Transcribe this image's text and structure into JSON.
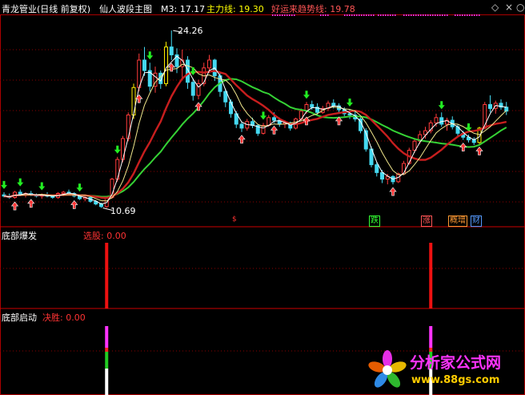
{
  "header": {
    "title": "青龙管业(日线 前复权)",
    "indicator": "仙人波段主图",
    "m3": "M3: 17.17",
    "main_line": "主力线: 19.30",
    "lucky_line": "好运来趋势线: 19.78"
  },
  "panels": {
    "p2_name": "底部爆发",
    "p2_signal": "选股: 0.00",
    "p3_name": "底部启动",
    "p3_signal": "决胜: 0.00"
  },
  "annotations": {
    "high": "24.26",
    "low": "10.69",
    "tags": [
      "跌",
      "涨",
      "概增",
      "财"
    ],
    "small_mark": "$"
  },
  "watermark": {
    "cn": "分析家公式网",
    "url": "www.88gs.com"
  },
  "colors": {
    "up": "#ff3b3b",
    "down": "#44d8f0",
    "ma_slow": "#c81e1e",
    "ma_green": "#35d235",
    "ma_white": "#ffffff",
    "ma_yellow": "#f0e68c",
    "magenta": "#ff33ff",
    "grid": "#8b0000"
  },
  "chart_data": {
    "type": "candlestick",
    "y_high": 24.26,
    "y_low": 10.69,
    "current": {
      "m3": 17.17,
      "main_line": 19.3,
      "lucky_line": 19.78
    },
    "ohlc": [
      [
        11.7,
        11.9,
        11.5,
        11.6
      ],
      [
        11.6,
        11.8,
        11.4,
        11.5
      ],
      [
        11.5,
        12.0,
        11.4,
        11.9
      ],
      [
        11.9,
        12.1,
        11.6,
        11.7
      ],
      [
        11.7,
        11.9,
        11.5,
        11.8
      ],
      [
        11.8,
        12.0,
        11.6,
        11.7
      ],
      [
        11.7,
        11.8,
        11.5,
        11.6
      ],
      [
        11.6,
        11.8,
        11.4,
        11.7
      ],
      [
        11.7,
        11.9,
        11.5,
        11.6
      ],
      [
        11.6,
        11.7,
        11.4,
        11.5
      ],
      [
        11.5,
        11.9,
        11.4,
        11.8
      ],
      [
        11.8,
        12.0,
        11.6,
        11.9
      ],
      [
        11.9,
        12.1,
        11.7,
        11.8
      ],
      [
        11.8,
        11.9,
        11.5,
        11.6
      ],
      [
        11.6,
        11.7,
        11.3,
        11.4
      ],
      [
        11.4,
        11.6,
        11.2,
        11.5
      ],
      [
        11.5,
        11.6,
        11.1,
        11.2
      ],
      [
        11.2,
        11.3,
        10.9,
        11.0
      ],
      [
        11.0,
        11.1,
        10.7,
        10.8
      ],
      [
        10.8,
        11.6,
        10.7,
        11.5
      ],
      [
        11.5,
        13.0,
        11.4,
        12.9
      ],
      [
        12.9,
        14.6,
        12.7,
        14.4
      ],
      [
        14.4,
        16.2,
        14.2,
        16.0
      ],
      [
        16.0,
        18.0,
        15.8,
        17.8
      ],
      [
        17.8,
        20.2,
        17.5,
        19.9
      ],
      [
        19.9,
        22.5,
        19.6,
        22.0
      ],
      [
        22.0,
        23.0,
        20.8,
        21.2
      ],
      [
        21.2,
        21.8,
        19.6,
        20.0
      ],
      [
        20.0,
        21.5,
        19.5,
        21.0
      ],
      [
        21.0,
        21.2,
        19.8,
        20.2
      ],
      [
        20.2,
        23.4,
        20.0,
        23.0
      ],
      [
        23.0,
        24.26,
        22.0,
        22.4
      ],
      [
        22.4,
        22.9,
        21.0,
        21.5
      ],
      [
        21.5,
        22.8,
        20.5,
        22.0
      ],
      [
        22.0,
        22.3,
        19.8,
        20.3
      ],
      [
        20.3,
        20.6,
        18.9,
        19.3
      ],
      [
        19.3,
        20.5,
        19.0,
        20.2
      ],
      [
        20.2,
        21.8,
        20.0,
        21.4
      ],
      [
        21.4,
        22.4,
        21.0,
        22.0
      ],
      [
        22.0,
        22.1,
        20.4,
        20.8
      ],
      [
        20.8,
        21.0,
        19.2,
        19.6
      ],
      [
        19.6,
        19.8,
        18.4,
        18.8
      ],
      [
        18.8,
        19.0,
        17.6,
        17.9
      ],
      [
        17.9,
        18.1,
        16.8,
        17.1
      ],
      [
        17.1,
        17.3,
        16.5,
        16.8
      ],
      [
        16.8,
        17.5,
        16.6,
        17.3
      ],
      [
        17.3,
        17.6,
        16.8,
        17.0
      ],
      [
        17.0,
        17.1,
        16.2,
        16.4
      ],
      [
        16.4,
        17.2,
        16.3,
        17.0
      ],
      [
        17.0,
        17.8,
        16.9,
        17.6
      ],
      [
        17.6,
        18.0,
        17.2,
        17.4
      ],
      [
        17.4,
        17.6,
        16.9,
        17.1
      ],
      [
        17.1,
        17.4,
        16.8,
        17.2
      ],
      [
        17.2,
        17.3,
        16.6,
        16.8
      ],
      [
        16.8,
        17.6,
        16.7,
        17.5
      ],
      [
        17.5,
        18.3,
        17.4,
        18.1
      ],
      [
        18.1,
        18.8,
        17.9,
        18.6
      ],
      [
        18.6,
        18.9,
        18.2,
        18.4
      ],
      [
        18.4,
        18.7,
        17.8,
        18.0
      ],
      [
        18.0,
        18.5,
        17.9,
        18.3
      ],
      [
        18.3,
        18.9,
        18.1,
        18.7
      ],
      [
        18.7,
        19.0,
        18.3,
        18.5
      ],
      [
        18.5,
        18.7,
        17.9,
        18.2
      ],
      [
        18.2,
        18.4,
        17.7,
        17.9
      ],
      [
        17.9,
        18.2,
        17.5,
        17.8
      ],
      [
        17.8,
        18.1,
        17.3,
        17.5
      ],
      [
        17.5,
        17.7,
        16.4,
        16.6
      ],
      [
        16.6,
        16.8,
        15.0,
        15.2
      ],
      [
        15.2,
        15.4,
        13.8,
        14.0
      ],
      [
        14.0,
        14.2,
        13.1,
        13.4
      ],
      [
        13.4,
        13.6,
        12.6,
        12.9
      ],
      [
        12.9,
        13.3,
        12.5,
        13.1
      ],
      [
        13.1,
        13.2,
        12.5,
        12.7
      ],
      [
        12.7,
        13.4,
        12.6,
        13.3
      ],
      [
        13.3,
        14.3,
        13.2,
        14.1
      ],
      [
        14.1,
        15.3,
        14.0,
        15.1
      ],
      [
        15.1,
        16.0,
        14.9,
        15.8
      ],
      [
        15.8,
        16.6,
        15.6,
        16.3
      ],
      [
        16.3,
        16.9,
        16.0,
        16.6
      ],
      [
        16.6,
        17.4,
        16.4,
        17.2
      ],
      [
        17.2,
        17.9,
        16.9,
        17.6
      ],
      [
        17.6,
        18.0,
        16.9,
        17.1
      ],
      [
        17.1,
        17.6,
        16.6,
        17.4
      ],
      [
        17.4,
        17.7,
        16.7,
        16.9
      ],
      [
        16.9,
        17.1,
        16.2,
        16.4
      ],
      [
        16.4,
        16.6,
        15.9,
        16.1
      ],
      [
        16.1,
        16.3,
        15.7,
        15.9
      ],
      [
        15.9,
        16.1,
        15.5,
        15.7
      ],
      [
        15.7,
        16.9,
        15.6,
        16.8
      ],
      [
        16.8,
        18.8,
        16.7,
        18.6
      ],
      [
        18.6,
        19.3,
        18.0,
        18.3
      ],
      [
        18.3,
        18.9,
        17.9,
        18.7
      ],
      [
        18.7,
        19.0,
        18.2,
        18.4
      ],
      [
        18.4,
        18.8,
        17.8,
        18.1
      ]
    ],
    "yellow_bars": [
      24,
      30,
      88
    ],
    "buy_arrows": [
      2,
      5,
      13,
      25,
      31,
      36,
      44,
      50,
      56,
      62,
      72,
      85,
      88
    ],
    "sell_arrows": [
      0,
      3,
      7,
      14,
      21,
      27,
      35,
      48,
      56,
      64,
      81,
      86
    ],
    "panel2_bars": [
      19,
      79
    ],
    "panel3_bars": [
      19,
      79
    ]
  }
}
